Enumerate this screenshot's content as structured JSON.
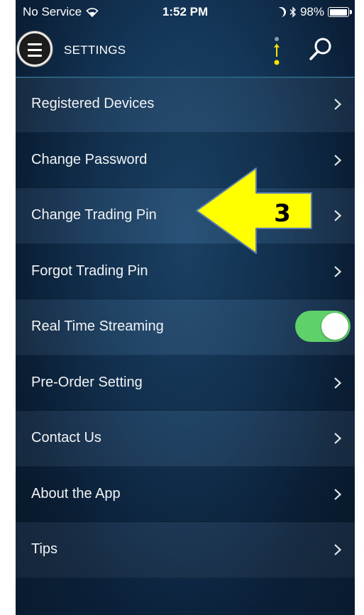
{
  "status_bar": {
    "carrier": "No Service",
    "time": "1:52 PM",
    "battery": "98%",
    "icons": [
      "wifi-icon",
      "moon-icon",
      "bluetooth-icon",
      "battery-icon"
    ]
  },
  "header": {
    "title": "SETTINGS",
    "icons": [
      "menu-icon",
      "info-icon",
      "search-icon"
    ]
  },
  "settings": {
    "items": [
      {
        "label": "Registered Devices"
      },
      {
        "label": "Change Password"
      },
      {
        "label": "Change Trading Pin"
      },
      {
        "label": "Forgot Trading Pin"
      },
      {
        "label": "Real Time Streaming",
        "toggle": true
      },
      {
        "label": "Pre-Order Setting"
      },
      {
        "label": "Contact Us"
      },
      {
        "label": "About the App"
      },
      {
        "label": "Tips"
      }
    ]
  },
  "annotation": {
    "label": "3",
    "icon": "arrow-left-icon",
    "color": "#ffff00"
  },
  "colors": {
    "background": "#143658",
    "toggle_on": "#5fd16a",
    "accent_yellow": "#f5e400"
  }
}
